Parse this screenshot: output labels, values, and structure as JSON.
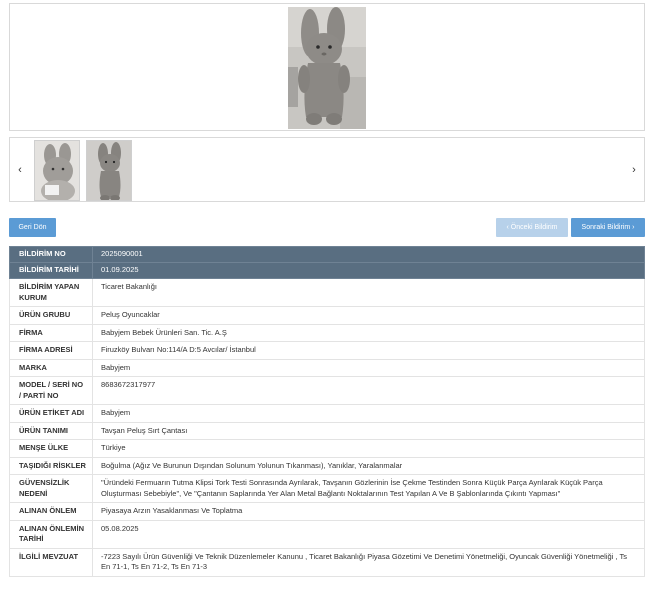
{
  "gallery": {
    "main_image": "plush-bunny-photo",
    "prev_arrow": "‹",
    "next_arrow": "›",
    "thumbnails": [
      "plush-bunny-thumbnail-1",
      "plush-bunny-thumbnail-2"
    ]
  },
  "buttons": {
    "back": "Geri Dön",
    "prev": "‹ Önceki Bildirim",
    "next": "Sonraki Bildirim ›"
  },
  "colors": {
    "header_row": "#596e81",
    "button_primary": "#5b9bd5",
    "button_disabled": "#b7d1ea"
  },
  "details": [
    {
      "label": "BİLDİRİM NO",
      "value": "2025090001"
    },
    {
      "label": "BİLDİRİM TARİHİ",
      "value": "01.09.2025"
    },
    {
      "label": "BİLDİRİM YAPAN KURUM",
      "value": "Ticaret Bakanlığı"
    },
    {
      "label": "ÜRÜN GRUBU",
      "value": "Peluş Oyuncaklar"
    },
    {
      "label": "FİRMA",
      "value": "Babyjem Bebek Ürünleri San. Tic. A.Ş"
    },
    {
      "label": "FİRMA ADRESİ",
      "value": "Firuzköy Bulvarı No:114/A D:5 Avcılar/ İstanbul"
    },
    {
      "label": "MARKA",
      "value": "Babyjem"
    },
    {
      "label": "MODEL / SERİ NO / PARTİ NO",
      "value": "8683672317977"
    },
    {
      "label": "ÜRÜN ETİKET ADI",
      "value": "Babyjem"
    },
    {
      "label": "ÜRÜN TANIMI",
      "value": "Tavşan Peluş Sırt Çantası"
    },
    {
      "label": "MENŞE ÜLKE",
      "value": "Türkiye"
    },
    {
      "label": "TAŞIDIĞI RİSKLER",
      "value": "Boğulma (Ağız Ve Burunun Dışından Solunum Yolunun Tıkanması), Yanıklar, Yaralanmalar"
    },
    {
      "label": "GÜVENSİZLİK NEDENİ",
      "value": "\"Üründeki Fermuarın Tutma Klipsi Tork Testi Sonrasında Ayrılarak, Tavşanın Gözlerinin İse Çekme Testinden Sonra Küçük Parça Ayrılarak Küçük Parça Oluşturması Sebebiyle\", Ve \"Çantanın Saplarında Yer Alan Metal Bağlantı Noktalarının Test Yapılan A Ve B Şablonlarında Çıkıntı Yapması\""
    },
    {
      "label": "ALINAN ÖNLEM",
      "value": "Piyasaya Arzın Yasaklanması Ve Toplatma"
    },
    {
      "label": "ALINAN ÖNLEMİN TARİHİ",
      "value": "05.08.2025"
    },
    {
      "label": "İLGİLİ MEVZUAT",
      "value": "-7223 Sayılı Ürün Güvenliği Ve Teknik Düzenlemeler Kanunu , Ticaret Bakanlığı Piyasa Gözetimi Ve Denetimi Yönetmeliği, Oyuncak Güvenliği Yönetmeliği , Ts En 71-1, Ts En 71-2, Ts En 71-3"
    }
  ]
}
